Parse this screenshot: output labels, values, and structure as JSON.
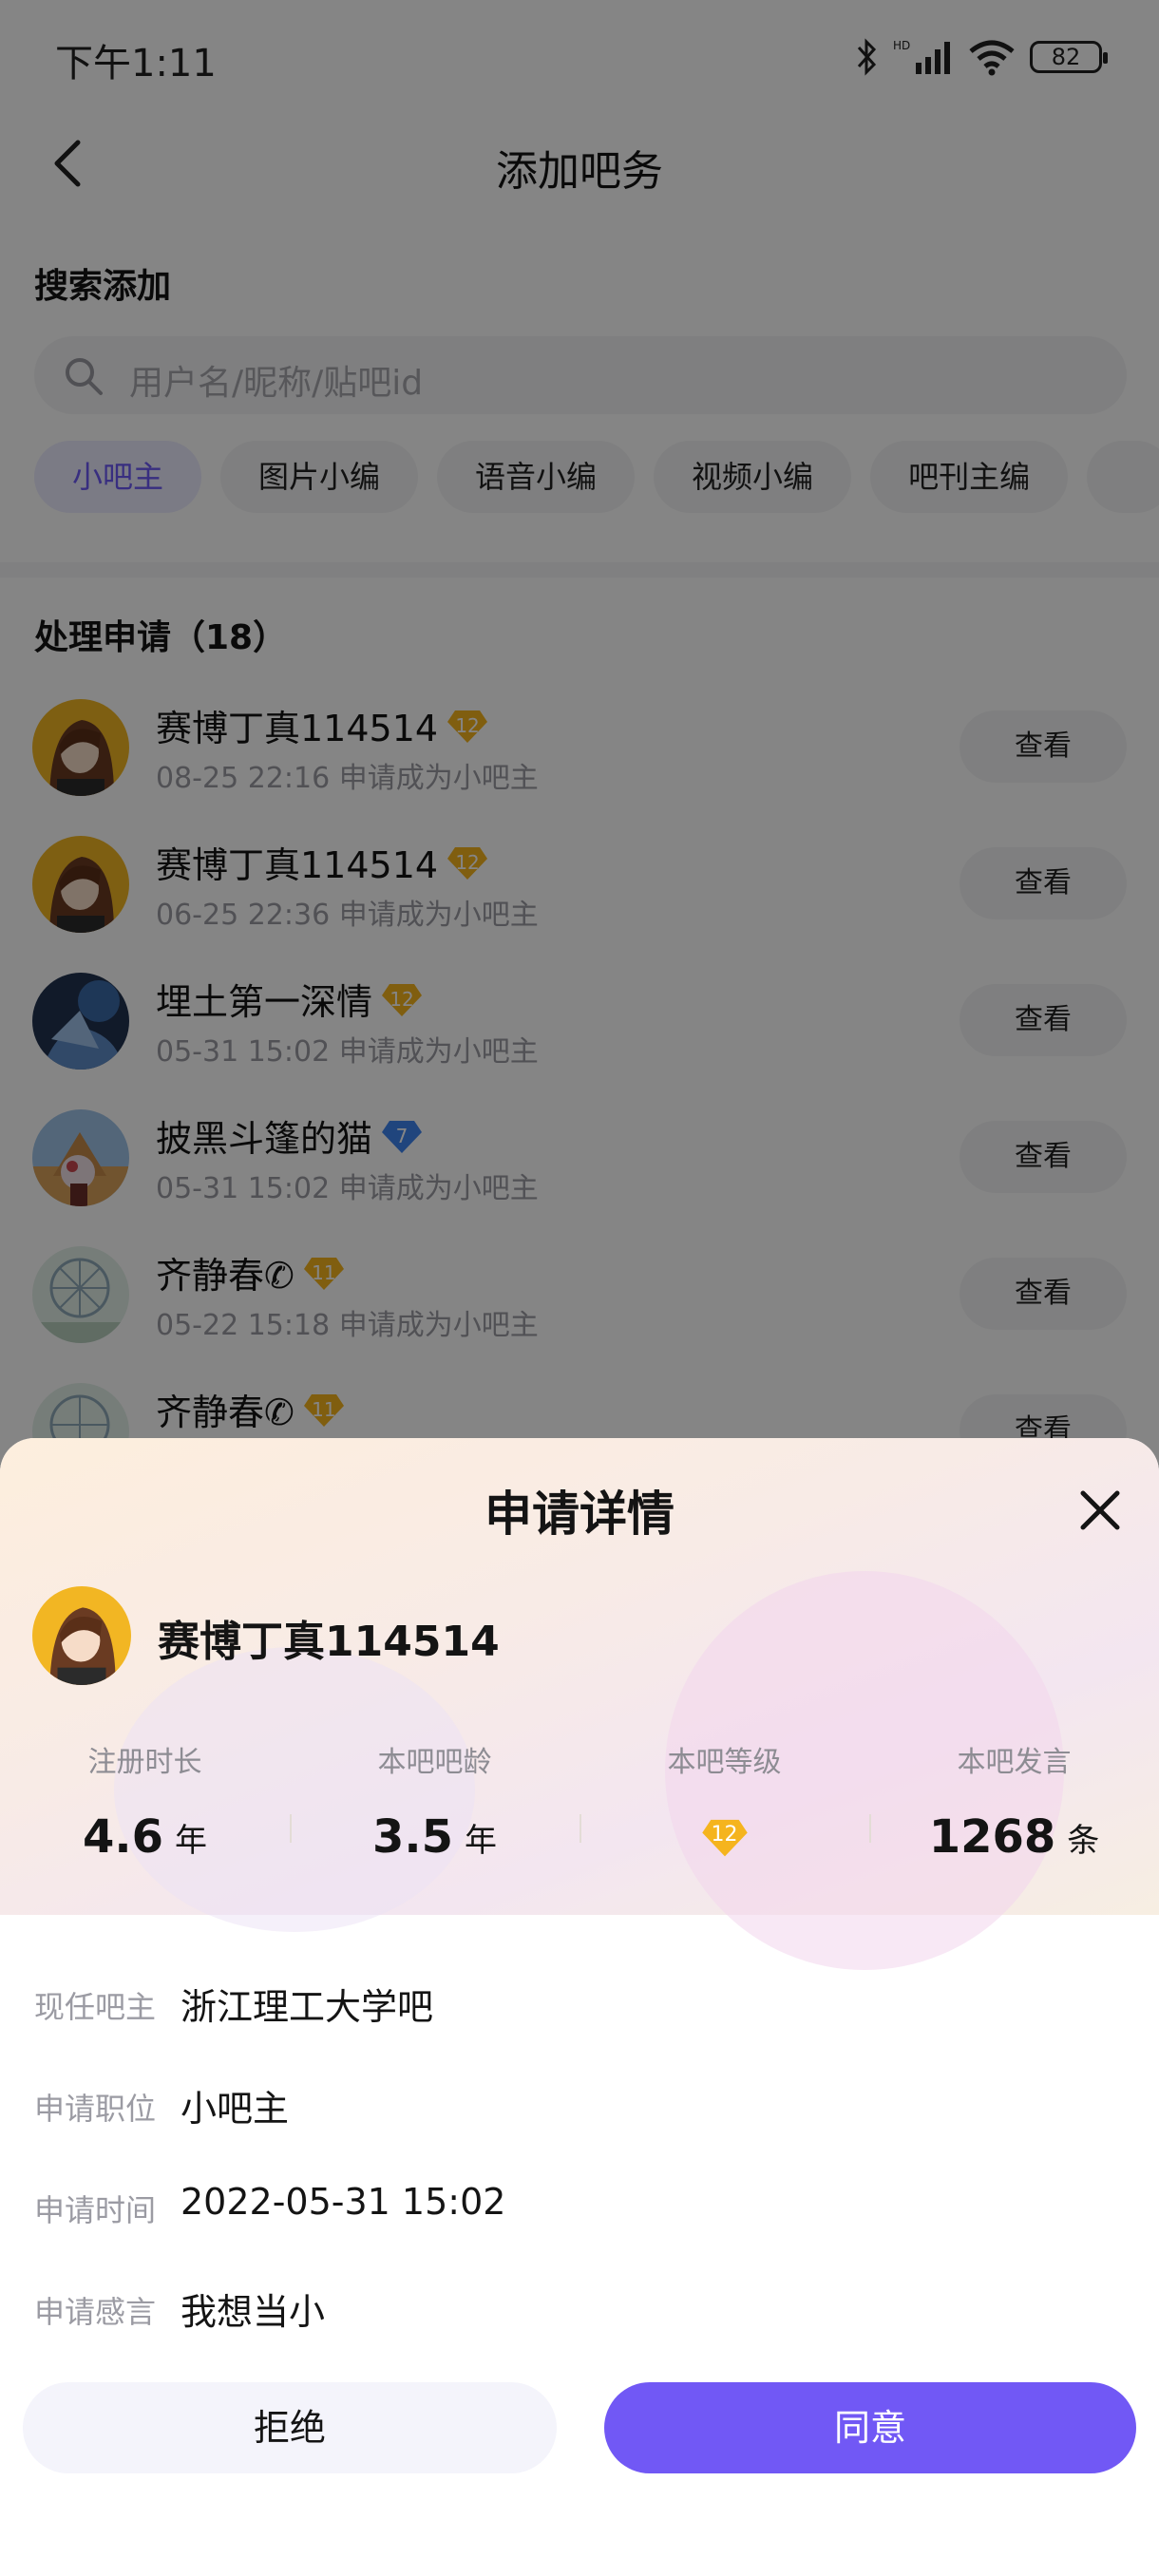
{
  "status_bar": {
    "time": "下午1:11",
    "battery": "82",
    "network": "HD"
  },
  "nav": {
    "title": "添加吧务"
  },
  "search": {
    "section_title": "搜索添加",
    "placeholder": "用户名/昵称/贴吧id",
    "roles": [
      "小吧主",
      "图片小编",
      "语音小编",
      "视频小编",
      "吧刊主编",
      "..."
    ],
    "active_role_index": 0
  },
  "requests": {
    "title": "处理申请（18）",
    "view_label": "查看",
    "items": [
      {
        "name": "赛博丁真114514",
        "level": "12",
        "badge_color": "#f5b41e",
        "meta": "08-25 22:16 申请成为小吧主",
        "avatar": "anime-girl"
      },
      {
        "name": "赛博丁真114514",
        "level": "12",
        "badge_color": "#f5b41e",
        "meta": "06-25 22:36 申请成为小吧主",
        "avatar": "anime-girl"
      },
      {
        "name": "埋土第一深情",
        "level": "12",
        "badge_color": "#f5b41e",
        "meta": "05-31 15:02 申请成为小吧主",
        "avatar": "blue-night"
      },
      {
        "name": "披黑斗篷的猫",
        "level": "7",
        "badge_color": "#3f84f0",
        "meta": "05-31 15:02 申请成为小吧主",
        "avatar": "pyramid-cat"
      },
      {
        "name": "齐静春✆",
        "level": "11",
        "badge_color": "#f5b41e",
        "meta": "05-22 15:18 申请成为小吧主",
        "avatar": "ferris-wheel"
      },
      {
        "name": "齐静春✆",
        "level": "11",
        "badge_color": "#f5b41e",
        "meta": "",
        "avatar": "ferris-wheel"
      }
    ]
  },
  "sheet": {
    "title": "申请详情",
    "applicant_name": "赛博丁真114514",
    "stats": [
      {
        "label": "注册时长",
        "value": "4.6",
        "unit": "年"
      },
      {
        "label": "本吧吧龄",
        "value": "3.5",
        "unit": "年"
      },
      {
        "label": "本吧等级",
        "level": "12"
      },
      {
        "label": "本吧发言",
        "value": "1268",
        "unit": "条"
      }
    ],
    "details": [
      {
        "label": "现任吧主",
        "value": "浙江理工大学吧"
      },
      {
        "label": "申请职位",
        "value": "小吧主"
      },
      {
        "label": "申请时间",
        "value": "2022-05-31 15:02"
      },
      {
        "label": "申请感言",
        "value": "我想当小"
      }
    ],
    "reject_label": "拒绝",
    "agree_label": "同意"
  },
  "colors": {
    "accent": "#7158f5",
    "gold_badge": "#f5b41e",
    "blue_badge": "#3f84f0"
  }
}
